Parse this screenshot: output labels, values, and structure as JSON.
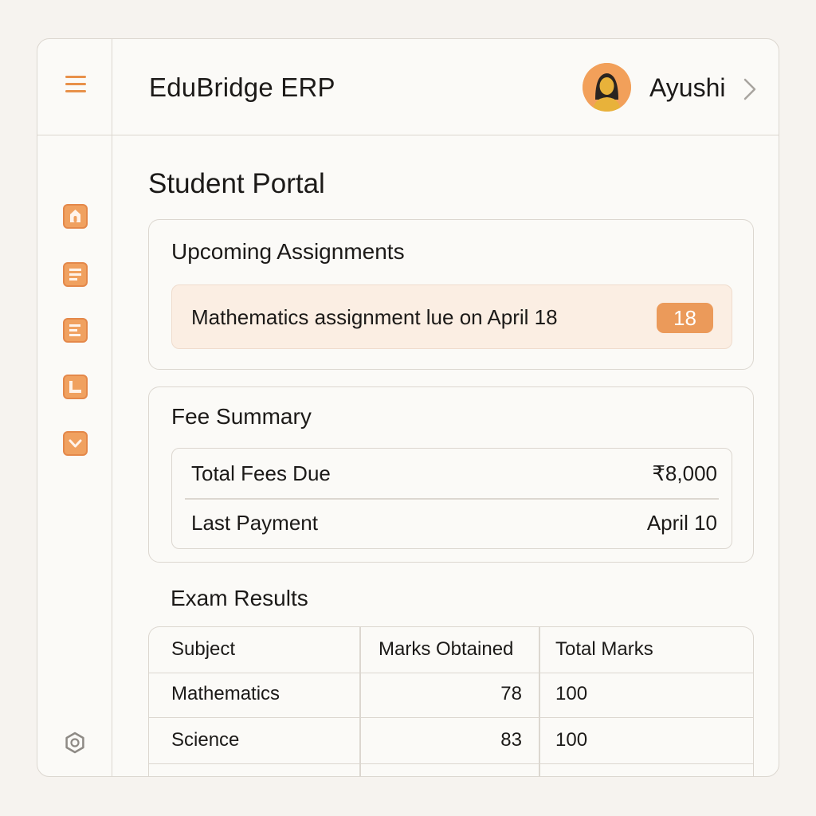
{
  "header": {
    "app_title": "EduBridge ERP",
    "user_name": "Ayushi"
  },
  "sidebar": {
    "items": [
      {
        "icon": "home-icon"
      },
      {
        "icon": "document-icon"
      },
      {
        "icon": "list-icon"
      },
      {
        "icon": "grid-icon"
      },
      {
        "icon": "chevron-down-icon"
      }
    ],
    "settings_icon": "settings-icon"
  },
  "main": {
    "page_title": "Student Portal",
    "assignments": {
      "title": "Upcoming Assignments",
      "items": [
        {
          "text": "Mathematics assignment lue on April 18",
          "badge": "18"
        }
      ]
    },
    "fees": {
      "title": "Fee Summary",
      "rows": [
        {
          "label": "Total Fees Due",
          "value": "₹8,000"
        },
        {
          "label": "Last Payment",
          "value": "April 10"
        }
      ]
    },
    "exams": {
      "title": "Exam Results",
      "columns": [
        "Subject",
        "Marks Obtained",
        "Total Marks"
      ],
      "rows": [
        {
          "subject": "Mathematics",
          "marks": "78",
          "total": "100"
        },
        {
          "subject": "Science",
          "marks": "83",
          "total": "100"
        }
      ]
    }
  },
  "colors": {
    "accent": "#eb9a5a",
    "accent_light": "#fbeee3",
    "border": "#dcd7d0",
    "background": "#f6f3ef"
  }
}
